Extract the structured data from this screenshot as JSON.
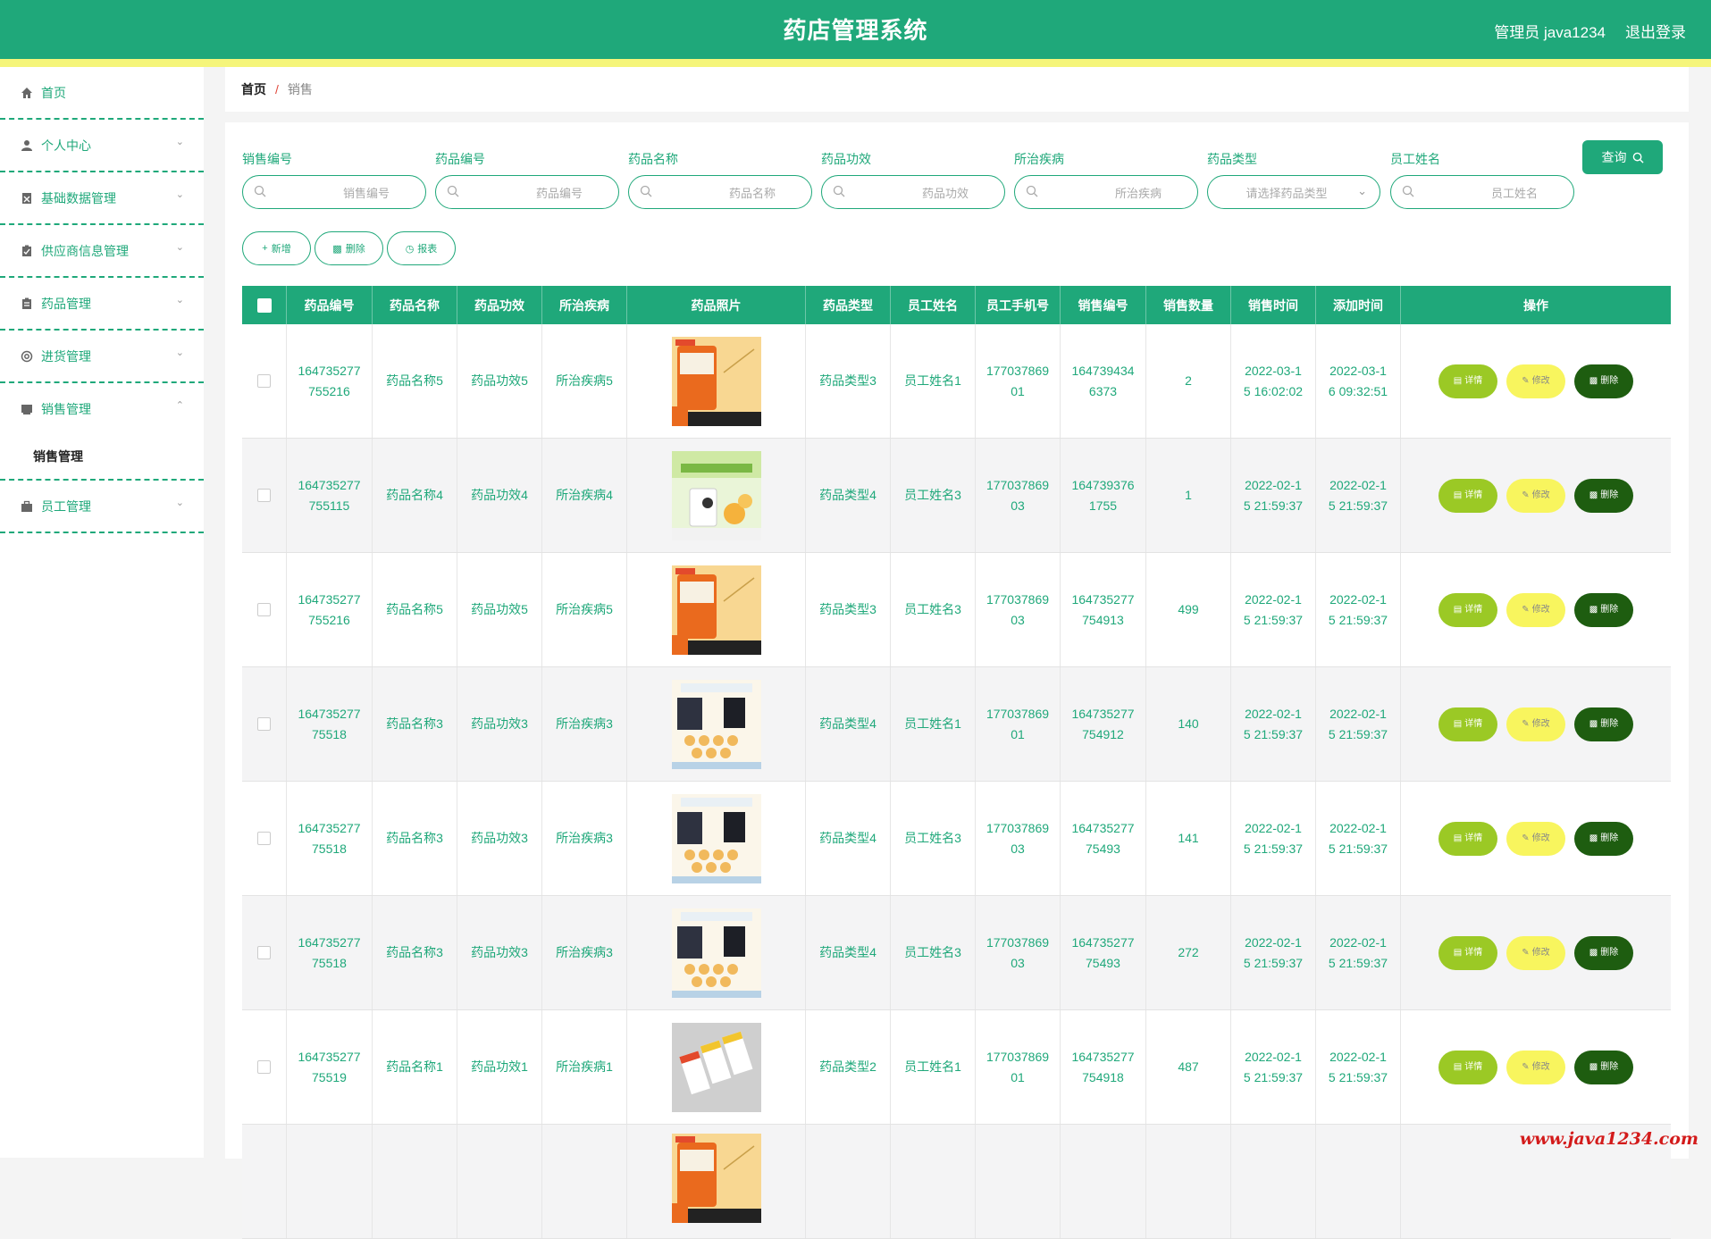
{
  "header": {
    "title": "药店管理系统",
    "user": "管理员 java1234",
    "logout": "退出登录"
  },
  "sidebar": {
    "items": [
      {
        "label": "首页",
        "icon": "home-icon"
      },
      {
        "label": "个人中心",
        "icon": "user-icon"
      },
      {
        "label": "基础数据管理",
        "icon": "database-icon"
      },
      {
        "label": "供应商信息管理",
        "icon": "clipboard-icon"
      },
      {
        "label": "药品管理",
        "icon": "medicine-icon"
      },
      {
        "label": "进货管理",
        "icon": "settings-icon"
      },
      {
        "label": "销售管理",
        "icon": "sales-icon"
      },
      {
        "label": "员工管理",
        "icon": "briefcase-icon"
      }
    ],
    "sub_sales": "销售管理"
  },
  "breadcrumb": {
    "home": "首页",
    "sep": "/",
    "current": "销售"
  },
  "filters": [
    {
      "label": "销售编号",
      "placeholder": "销售编号"
    },
    {
      "label": "药品编号",
      "placeholder": "药品编号"
    },
    {
      "label": "药品名称",
      "placeholder": "药品名称"
    },
    {
      "label": "药品功效",
      "placeholder": "药品功效"
    },
    {
      "label": "所治疾病",
      "placeholder": "所治疾病"
    },
    {
      "label": "药品类型",
      "placeholder": "请选择药品类型"
    },
    {
      "label": "员工姓名",
      "placeholder": "员工姓名"
    }
  ],
  "query_button": "查询",
  "actions": {
    "add": "新增",
    "delete": "删除",
    "report": "报表"
  },
  "table": {
    "headers": [
      "药品编号",
      "药品名称",
      "药品功效",
      "所治疾病",
      "药品照片",
      "药品类型",
      "员工姓名",
      "员工手机号",
      "销售编号",
      "销售数量",
      "销售时间",
      "添加时间",
      "操作"
    ],
    "op_labels": {
      "detail": "详情",
      "edit": "修改",
      "delete": "删除"
    },
    "rows": [
      {
        "drug_no": "164735277\n755216",
        "name": "药品名称5",
        "effect": "药品功效5",
        "disease": "所治疾病5",
        "photo": "orange-jar",
        "type": "药品类型3",
        "emp": "员工姓名1",
        "phone": "177037869\n01",
        "sale_no": "164739434\n6373",
        "qty": "2",
        "sale_time": "2022-03-1\n5 16:02:02",
        "add_time": "2022-03-1\n6 09:32:51"
      },
      {
        "drug_no": "164735277\n755115",
        "name": "药品名称4",
        "effect": "药品功效4",
        "disease": "所治疾病4",
        "photo": "vitamin-c",
        "type": "药品类型4",
        "emp": "员工姓名3",
        "phone": "177037869\n03",
        "sale_no": "164739376\n1755",
        "qty": "1",
        "sale_time": "2022-02-1\n5 21:59:37",
        "add_time": "2022-02-1\n5 21:59:37"
      },
      {
        "drug_no": "164735277\n755216",
        "name": "药品名称5",
        "effect": "药品功效5",
        "disease": "所治疾病5",
        "photo": "orange-jar",
        "type": "药品类型3",
        "emp": "员工姓名3",
        "phone": "177037869\n03",
        "sale_no": "164735277\n754913",
        "qty": "499",
        "sale_time": "2022-02-1\n5 21:59:37",
        "add_time": "2022-02-1\n5 21:59:37"
      },
      {
        "drug_no": "164735277\n75518",
        "name": "药品名称3",
        "effect": "药品功效3",
        "disease": "所治疾病3",
        "photo": "calcium-box",
        "type": "药品类型4",
        "emp": "员工姓名1",
        "phone": "177037869\n01",
        "sale_no": "164735277\n754912",
        "qty": "140",
        "sale_time": "2022-02-1\n5 21:59:37",
        "add_time": "2022-02-1\n5 21:59:37"
      },
      {
        "drug_no": "164735277\n75518",
        "name": "药品名称3",
        "effect": "药品功效3",
        "disease": "所治疾病3",
        "photo": "calcium-box",
        "type": "药品类型4",
        "emp": "员工姓名3",
        "phone": "177037869\n03",
        "sale_no": "164735277\n75493",
        "qty": "141",
        "sale_time": "2022-02-1\n5 21:59:37",
        "add_time": "2022-02-1\n5 21:59:37"
      },
      {
        "drug_no": "164735277\n75518",
        "name": "药品名称3",
        "effect": "药品功效3",
        "disease": "所治疾病3",
        "photo": "calcium-box",
        "type": "药品类型4",
        "emp": "员工姓名3",
        "phone": "177037869\n03",
        "sale_no": "164735277\n75493",
        "qty": "272",
        "sale_time": "2022-02-1\n5 21:59:37",
        "add_time": "2022-02-1\n5 21:59:37"
      },
      {
        "drug_no": "164735277\n75519",
        "name": "药品名称1",
        "effect": "药品功效1",
        "disease": "所治疾病1",
        "photo": "packets",
        "type": "药品类型2",
        "emp": "员工姓名1",
        "phone": "177037869\n01",
        "sale_no": "164735277\n754918",
        "qty": "487",
        "sale_time": "2022-02-1\n5 21:59:37",
        "add_time": "2022-02-1\n5 21:59:37"
      },
      {
        "drug_no": "",
        "name": "",
        "effect": "",
        "disease": "",
        "photo": "orange-jar",
        "type": "",
        "emp": "",
        "phone": "",
        "sale_no": "",
        "qty": "",
        "sale_time": "",
        "add_time": ""
      }
    ]
  },
  "watermark": "www.java1234.com",
  "colors": {
    "primary": "#1fa87a",
    "accent_bar": "#f5f57a",
    "detail": "#9bc925",
    "edit": "#f8f55e",
    "delete": "#1e5d10"
  }
}
